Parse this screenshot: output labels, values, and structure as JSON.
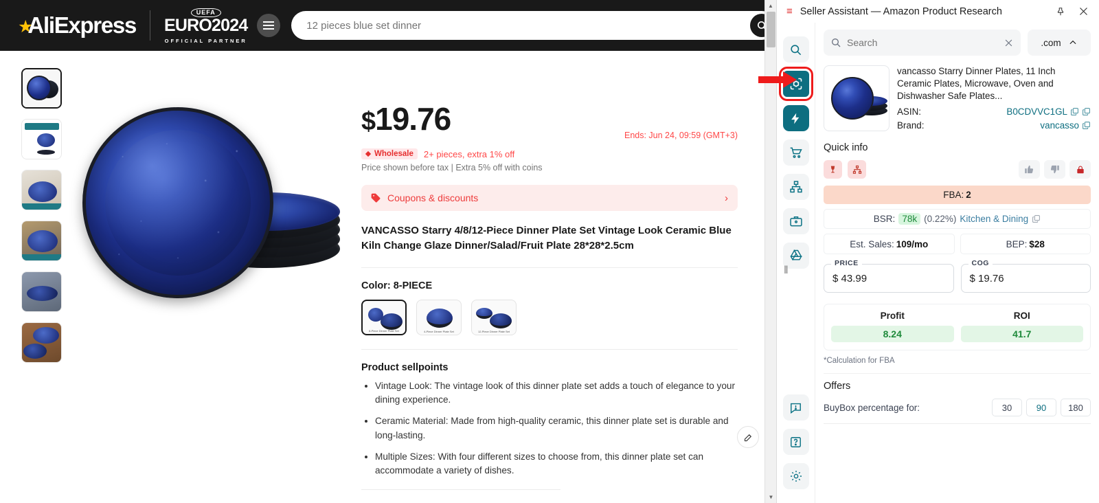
{
  "aliexpress": {
    "logo_text": "AliExpress",
    "partner_badge": "UEFA",
    "partner_name": "EURO2024",
    "partner_sub": "OFFICIAL PARTNER",
    "search_value": "12 pieces blue set dinner",
    "search_placeholder": "12 pieces blue set dinner",
    "price": "19.76",
    "currency": "$",
    "ends_text": "Ends: Jun 24, 09:59 (GMT+3)",
    "wholesale_tag": "Wholesale",
    "wholesale_note": "2+ pieces, extra 1% off",
    "tax_note": "Price shown before tax | Extra 5% off with coins",
    "coupons_label": "Coupons & discounts",
    "coupons_chevron": "›",
    "product_title": "VANCASSO Starry 4/8/12-Piece Dinner Plate Set Vintage Look Ceramic Blue Kiln Change Glaze Dinner/Salad/Fruit Plate 28*28*2.5cm",
    "color_label": "Color: 8-PIECE",
    "swatches": [
      {
        "caption": "8-Piece Dinner Plate Set",
        "selected": true
      },
      {
        "caption": "4-Piece Dinner Plate Set",
        "selected": false
      },
      {
        "caption": "12-Piece Dinner Plate Set",
        "selected": false
      }
    ],
    "sellpoints_heading": "Product sellpoints",
    "sellpoints": [
      "Vintage Look: The vintage look of this dinner plate set adds a touch of elegance to your dining experience.",
      "Ceramic Material: Made from high-quality ceramic, this dinner plate set is durable and long-lasting.",
      "Multiple Sizes: With four different sizes to choose from, this dinner plate set can accommodate a variety of dishes."
    ],
    "thumbnails": [
      {
        "name": "thumbnail-1-plate-front",
        "selected": true
      },
      {
        "name": "thumbnail-2-size-diagram",
        "selected": false
      },
      {
        "name": "thumbnail-3-table-setting",
        "selected": false
      },
      {
        "name": "thumbnail-4-cutlery",
        "selected": false
      },
      {
        "name": "thumbnail-5-held-plate",
        "selected": false
      },
      {
        "name": "thumbnail-6-meal",
        "selected": false
      }
    ],
    "edit_icon": "pencil-icon",
    "search_icon": "search-icon",
    "menu_icon": "hamburger-menu-icon"
  },
  "extension": {
    "logo_icon": "seller-assistant-logo",
    "title": "Seller Assistant — Amazon Product Research",
    "pin_icon": "pin-icon",
    "close_icon": "close-icon",
    "search": {
      "placeholder": "Search",
      "value": "",
      "clear_icon": "close-icon",
      "icon": "search-icon"
    },
    "domain": {
      "value": ".com",
      "chevron": "chevron-up-icon"
    },
    "rail": [
      {
        "name": "rail-search",
        "icon": "search-icon",
        "state": "plain"
      },
      {
        "name": "rail-product-research",
        "icon": "cube-scan-icon",
        "state": "active-highlighted"
      },
      {
        "name": "rail-quick-view",
        "icon": "bolt-icon",
        "state": "active"
      },
      {
        "name": "rail-cart",
        "icon": "shopping-cart-icon",
        "state": "plain"
      },
      {
        "name": "rail-variations",
        "icon": "sitemap-icon",
        "state": "plain"
      },
      {
        "name": "rail-suppliers",
        "icon": "briefcase-icon",
        "state": "plain"
      },
      {
        "name": "rail-drive",
        "icon": "google-drive-icon",
        "state": "plain"
      },
      {
        "name": "rail-alerts",
        "icon": "alert-chat-icon",
        "state": "plain"
      },
      {
        "name": "rail-help",
        "icon": "question-box-icon",
        "state": "plain"
      },
      {
        "name": "rail-settings",
        "icon": "gear-icon",
        "state": "plain"
      }
    ],
    "product": {
      "title": "vancasso Starry Dinner Plates, 11 Inch Ceramic Plates, Microwave, Oven and Dishwasher Safe Plates...",
      "asin_label": "ASIN:",
      "asin_value": "B0CDVVC1GL",
      "brand_label": "Brand:",
      "brand_value": "vancasso",
      "copy_icon": "copy-icon"
    },
    "quick_info": {
      "heading": "Quick info",
      "chips": [
        {
          "name": "fragile-icon",
          "glyph": "ᴛ"
        },
        {
          "name": "variations-icon",
          "glyph": "sitemap"
        }
      ],
      "actions": [
        {
          "name": "thumbs-up-button",
          "icon": "thumbs-up-icon"
        },
        {
          "name": "thumbs-down-button",
          "icon": "thumbs-down-icon"
        },
        {
          "name": "restricted-lock-button",
          "icon": "lock-icon"
        }
      ],
      "fba_label": "FBA:",
      "fba_value": "2",
      "bsr_label": "BSR:",
      "bsr_value": "78k",
      "bsr_pct": "(0.22%)",
      "bsr_category": "Kitchen & Dining",
      "est_sales_label": "Est. Sales:",
      "est_sales_value": "109/mo",
      "bep_label": "BEP:",
      "bep_value": "$28"
    },
    "inputs": {
      "price_label": "PRICE",
      "price_value": "$ 43.99",
      "cog_label": "COG",
      "cog_value": "$ 19.76"
    },
    "profit": {
      "profit_label": "Profit",
      "profit_value": "8.24",
      "roi_label": "ROI",
      "roi_value": "41.7",
      "note": "*Calculation for FBA"
    },
    "offers": {
      "heading": "Offers",
      "buybox_label": "BuyBox percentage for:",
      "ranges": [
        {
          "label": "30",
          "selected": false
        },
        {
          "label": "90",
          "selected": true
        },
        {
          "label": "180",
          "selected": false
        }
      ]
    }
  },
  "colors": {
    "accent_teal": "#0d6e80",
    "annotation_red": "#ee1b1b",
    "aliexpress_red": "#ee3b3b",
    "green": "#1f8a3b"
  }
}
